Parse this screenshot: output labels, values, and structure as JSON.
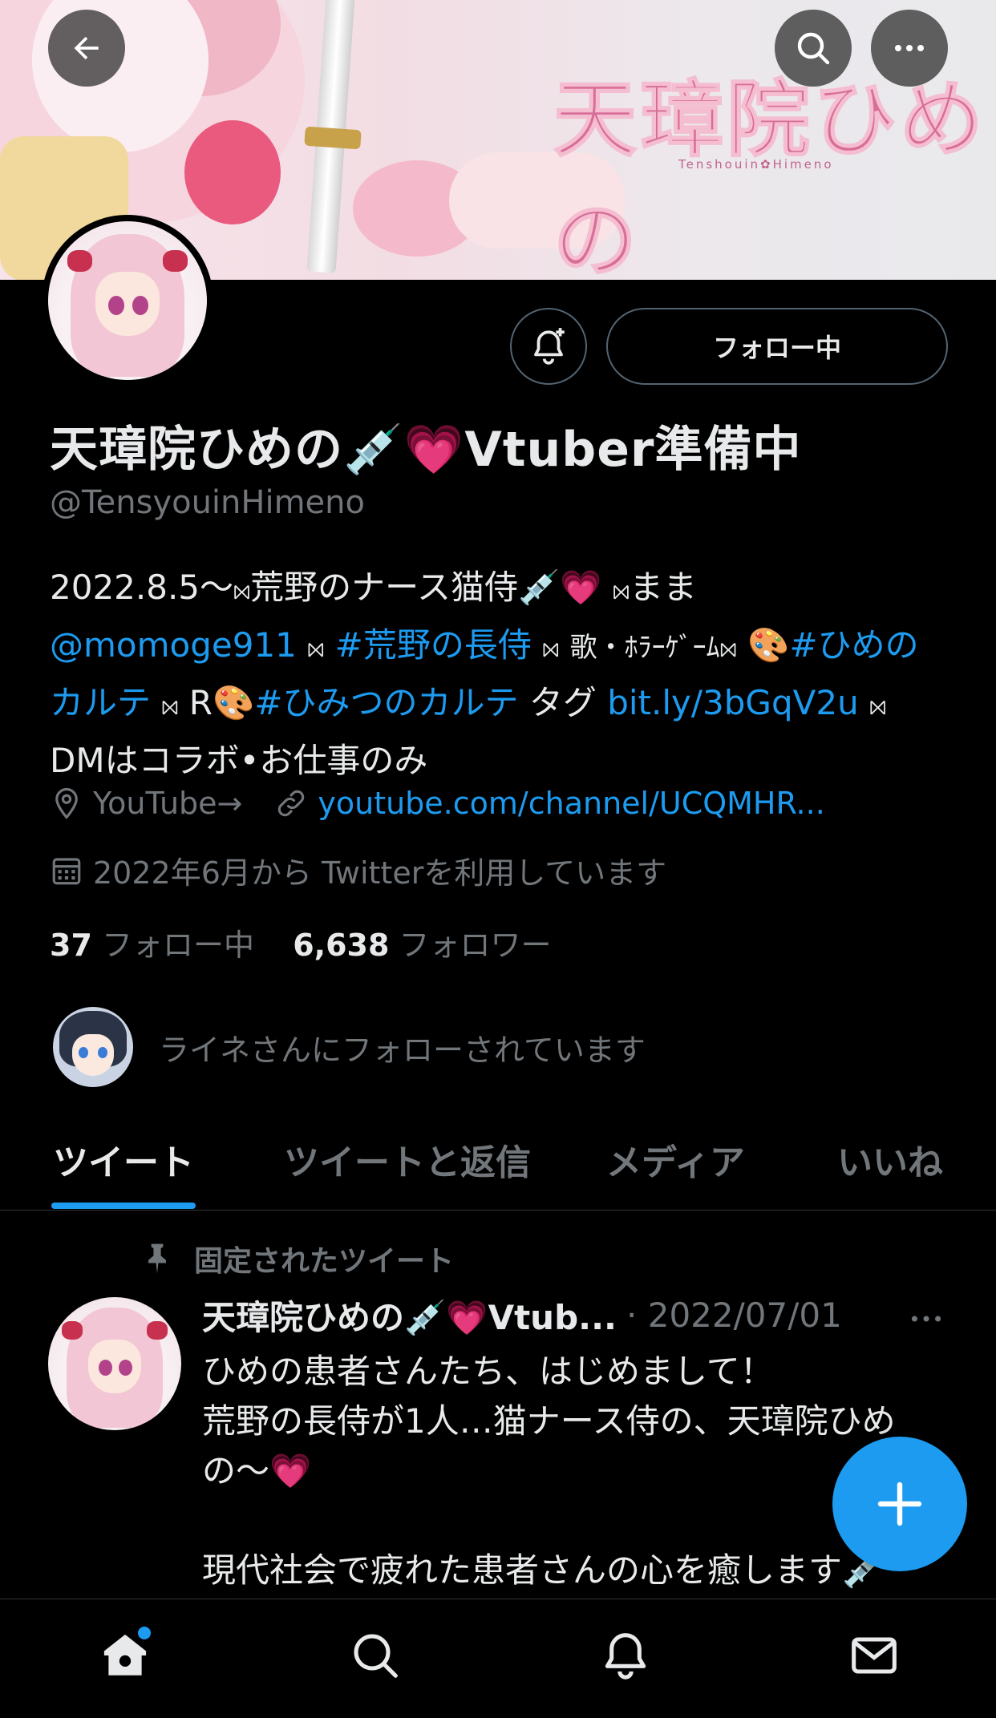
{
  "banner": {
    "logo_text": "天璋院ひめの",
    "logo_sub": "Tenshouin✿Himeno"
  },
  "header": {
    "back_icon": "arrow-left-icon",
    "search_icon": "search-icon",
    "more_icon": "more-horizontal-icon"
  },
  "profile": {
    "display_name": "天璋院ひめの💉💗Vtuber準備中",
    "handle": "@TensyouinHimeno",
    "follow_button_label": "フォロー中",
    "notify_icon": "bell-plus-icon",
    "bio": {
      "line1_text": "2022.8.5〜",
      "line1_sep": "⨝",
      "line1_rest": "荒野のナース猫侍💉💗",
      "line1_sep2": "⨝",
      "line1_end": "まま",
      "mention": "@momoge911",
      "sep_a": "⨝",
      "hashtag1": "#荒野の長侍",
      "sep_b": "⨝",
      "mid_text": "歌・ﾎﾗｰｹﾞｰﾑ",
      "sep_c": "⨝",
      "palette1": "🎨",
      "hashtag2": "#ひめのカルテ",
      "sep_d": "⨝",
      "r_text": "R🎨",
      "hashtag3": "#ひみつのカルテ",
      "tag_text": "タグ",
      "link": "bit.ly/3bGqV2u",
      "sep_e": "⨝",
      "dm_text": "DMはコラボ•お仕事のみ"
    },
    "location": "YouTube→",
    "url": "youtube.com/channel/UCQMHR...",
    "joined": "2022年6月から Twitterを利用しています",
    "following_count": "37",
    "following_label": "フォロー中",
    "followers_count": "6,638",
    "followers_label": "フォロワー",
    "followed_by_text": "ライネさんにフォローされています"
  },
  "tabs": [
    {
      "label": "ツイート",
      "active": true
    },
    {
      "label": "ツイートと返信",
      "active": false
    },
    {
      "label": "メディア",
      "active": false
    },
    {
      "label": "いいね",
      "active": false
    }
  ],
  "tweet": {
    "pinned_label": "固定されたツイート",
    "author": "天璋院ひめの💉💗Vtub...",
    "date": "· 2022/07/01",
    "lines": [
      "ひめの患者さんたち、はじめまして！",
      "荒野の長侍が1人…猫ナース侍の、天璋院ひめ",
      "の〜💗",
      "",
      "現代社会で疲れた患者さんの心を癒します💉"
    ]
  },
  "bottom_nav": [
    "home-icon",
    "search-icon",
    "bell-icon",
    "mail-icon"
  ],
  "colors": {
    "accent": "#1d9bf0",
    "background": "#000000",
    "secondary_text": "#71767b",
    "primary_text": "#e7e9ea"
  }
}
